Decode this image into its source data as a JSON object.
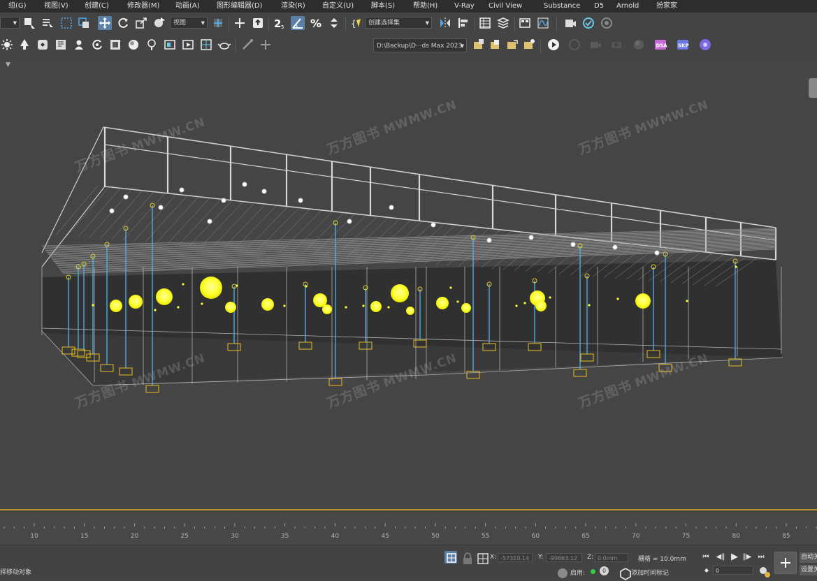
{
  "menu": [
    "组(G)",
    "视图(V)",
    "创建(C)",
    "修改器(M)",
    "动画(A)",
    "图形编辑器(D)",
    "渲染(R)",
    "自定义(U)",
    "脚本(S)",
    "帮助(H)",
    "V-Ray",
    "Civil View",
    "Substance",
    "D5",
    "Arnold",
    "扮家家"
  ],
  "toolbar": {
    "viewport_combo": "视图",
    "selection_set_combo": "创建选择集",
    "path_combo": "D:\\Backup\\D···ds Max 2023",
    "d5a_label": "D5A",
    "skp_label": "SKP"
  },
  "watermark": {
    "cn": "万方图书",
    "en": "MWMW.CN"
  },
  "timeline": {
    "ticks": [
      10,
      15,
      20,
      25,
      30,
      35,
      40,
      45,
      50,
      55,
      60,
      65,
      70,
      75,
      80,
      85
    ]
  },
  "status": {
    "prompt": "择移动对象",
    "x_label": "X:",
    "x_value": "-57310.14",
    "y_label": "Y:",
    "y_value": "-99663.12",
    "z_label": "Z:",
    "z_value": "0.0mm",
    "grid_label": "栅格 = 10.0mm",
    "enable_label": "启用:",
    "enable_count": "0",
    "add_time_tag": "添加时间标记",
    "frame_value": "0",
    "auto_key": "自动关",
    "set_key": "设置关"
  },
  "colors": {
    "menubar_bg": "#2d2d2d",
    "toolbar_bg": "#444444",
    "viewport_bg": "#454545",
    "wire": "#d8d8d8",
    "light": "#ffff33",
    "light_stem": "#4fb4e8",
    "accent_active": "#5b7fa6",
    "timeline_accent": "#b8902f"
  }
}
